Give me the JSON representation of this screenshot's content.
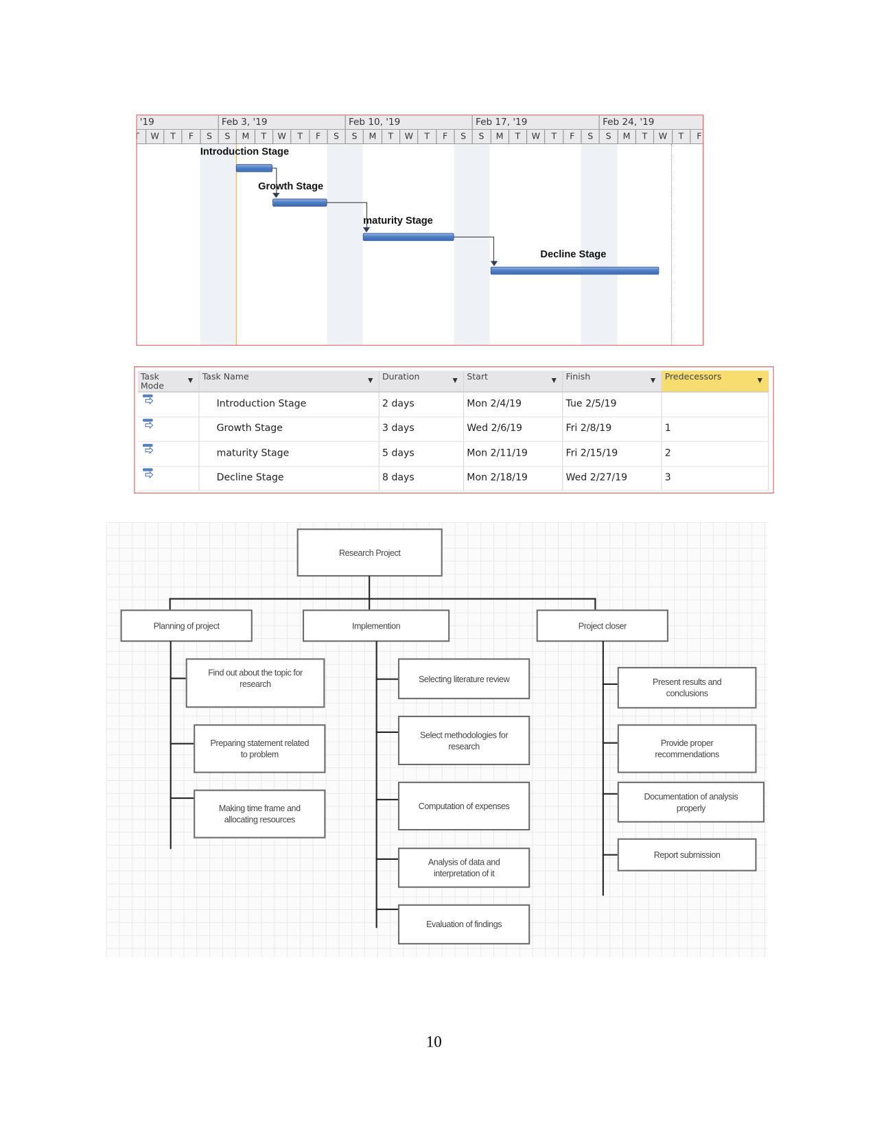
{
  "gantt": {
    "partial_week_label": "'19",
    "weeks": [
      "Feb 3, '19",
      "Feb 10, '19",
      "Feb 17, '19",
      "Feb 24, '19"
    ],
    "day_letters": [
      "T",
      "W",
      "T",
      "F",
      "S",
      "S",
      "M",
      "T",
      "W",
      "T",
      "F",
      "S",
      "S",
      "M",
      "T",
      "W",
      "T",
      "F",
      "S",
      "S",
      "M",
      "T",
      "W",
      "T",
      "F",
      "S",
      "S",
      "M",
      "T",
      "W",
      "T",
      "F"
    ],
    "tasks": [
      {
        "name": "Introduction Stage",
        "start": "2019-02-04",
        "finish": "2019-02-05"
      },
      {
        "name": "Growth Stage",
        "start": "2019-02-06",
        "finish": "2019-02-08"
      },
      {
        "name": "maturity Stage",
        "start": "2019-02-11",
        "finish": "2019-02-15"
      },
      {
        "name": "Decline Stage",
        "start": "2019-02-18",
        "finish": "2019-02-27"
      }
    ],
    "bar_color": "#4f7fc4",
    "frame_color": "#d9534f"
  },
  "table": {
    "headers": [
      "Task Mode",
      "Task Name",
      "Duration",
      "Start",
      "Finish",
      "Predecessors"
    ],
    "rows": [
      {
        "name": "Introduction Stage",
        "duration": "2 days",
        "start": "Mon 2/4/19",
        "finish": "Tue 2/5/19",
        "predecessors": ""
      },
      {
        "name": "Growth Stage",
        "duration": "3 days",
        "start": "Wed 2/6/19",
        "finish": "Fri 2/8/19",
        "predecessors": "1"
      },
      {
        "name": "maturity Stage",
        "duration": "5 days",
        "start": "Mon 2/11/19",
        "finish": "Fri 2/15/19",
        "predecessors": "2"
      },
      {
        "name": "Decline Stage",
        "duration": "8 days",
        "start": "Mon 2/18/19",
        "finish": "Wed 2/27/19",
        "predecessors": "3"
      }
    ],
    "highlight_color": "#f7dc6f"
  },
  "wbs": {
    "root": "Research Project",
    "branches": [
      {
        "label": "Planning of project",
        "children": [
          "Find out about the topic for research",
          "Preparing statement related to problem",
          "Making time frame and allocating resources"
        ]
      },
      {
        "label": "Implemention",
        "children": [
          "Selecting literature review",
          "Select methodologies for research",
          "Computation of expenses",
          "Analysis of data and interpretation of it",
          "Evaluation of findings"
        ]
      },
      {
        "label": "Project closer",
        "children": [
          "Present results and conclusions",
          "Provide proper recommendations",
          "Documentation of analysis properly",
          "Report submission"
        ]
      }
    ]
  },
  "page_number": "10"
}
